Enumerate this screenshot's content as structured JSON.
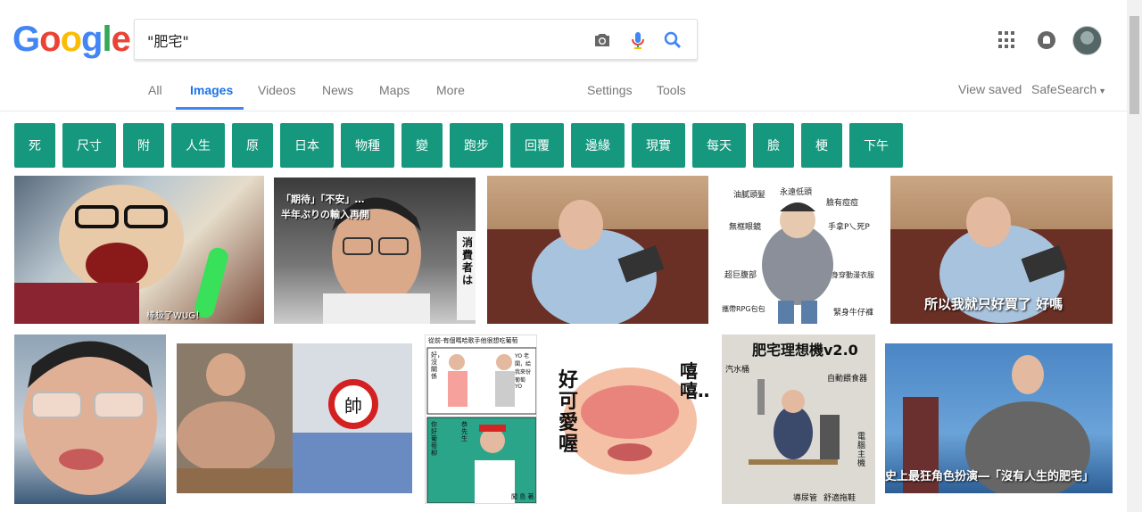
{
  "search": {
    "query": "\"肥宅\""
  },
  "logo": {
    "letters": [
      "G",
      "o",
      "o",
      "g",
      "l",
      "e"
    ],
    "colors": [
      "#4285f4",
      "#ea4335",
      "#fbbc05",
      "#4285f4",
      "#34a853",
      "#ea4335"
    ]
  },
  "tabs": {
    "all": "All",
    "images": "Images",
    "videos": "Videos",
    "news": "News",
    "maps": "Maps",
    "more": "More",
    "settings": "Settings",
    "tools": "Tools"
  },
  "header_right": {
    "view_saved": "View saved",
    "safesearch": "SafeSearch"
  },
  "chips": [
    "死",
    "尺寸",
    "附",
    "人生",
    "原",
    "日本",
    "物種",
    "變",
    "跑步",
    "回覆",
    "邊緣",
    "現實",
    "每天",
    "臉",
    "梗",
    "下午"
  ],
  "images": {
    "caption1": "棒极了WUG！",
    "caption2_line1": "「期待」「不安」…",
    "caption2_line2": "半年ぶりの輸入再開",
    "caption2_sign": "消費者は",
    "caption4": [
      "油膩頭髮",
      "永遠低頭",
      "臉有痘痘",
      "無框眼鏡",
      "手拿P乀死P",
      "超巨腹部",
      "身穿動漫衣服",
      "攜帶RPG包包",
      "緊身牛仔褲"
    ],
    "caption5": "所以我就只好買了  好嗎",
    "caption7_badge": "帥",
    "caption8_texts": [
      "從前-有個嗎哈歌手他很想吃葡萄",
      "好，沒關係",
      "YO 老闆，給我來份葡萄YO",
      "你好，",
      "你好 葡萄 柳",
      "恭 先生",
      "闖 島 著"
    ],
    "caption9": [
      "好可愛喔",
      "嘻嘻……"
    ],
    "caption10_title": "肥宅理想機v2.0",
    "caption10_labels": [
      "汽水桶",
      "自動餵食器",
      "電腦主機",
      "導尿管",
      "舒適拖鞋"
    ],
    "caption11": "史上最狂角色扮演―「沒有人生的肥宅」"
  },
  "colors": {
    "chip": "#15987e",
    "accent": "#4285f4"
  }
}
